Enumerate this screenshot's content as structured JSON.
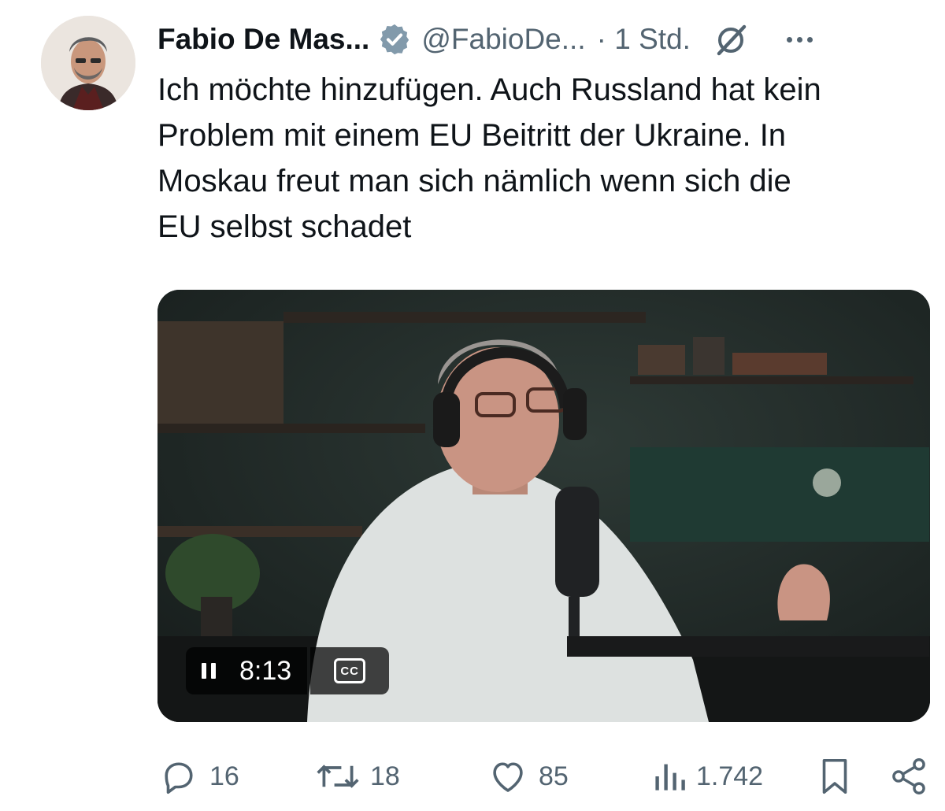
{
  "author": {
    "name": "Fabio De Mas...",
    "handle": "@FabioDe...",
    "time": "· 1 Std."
  },
  "tweet": {
    "lines": [
      "Ich möchte hinzufügen. Auch Russland hat kein",
      "Problem mit einem EU Beitritt der Ukraine. In",
      "Moskau freut man sich nämlich wenn sich die",
      "EU selbst schadet"
    ]
  },
  "video": {
    "duration": "8:13",
    "cc_label": "CC"
  },
  "actions": {
    "replies": "16",
    "reposts": "18",
    "likes": "85",
    "views": "1.742"
  },
  "icons": {
    "verified": "verified-badge-icon",
    "grok": "grok-icon",
    "more": "more-icon",
    "reply": "reply-icon",
    "repost": "repost-icon",
    "like": "like-icon",
    "views": "views-icon",
    "bookmark": "bookmark-icon",
    "share": "share-icon"
  },
  "colors": {
    "text": "#0f1419",
    "secondary": "#536471",
    "verified_badge": "#829aab"
  }
}
